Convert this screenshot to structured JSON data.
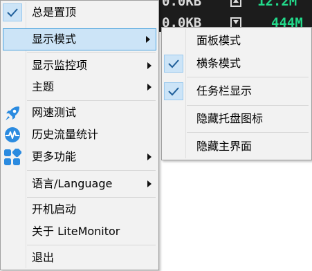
{
  "background": {
    "top_row": {
      "speed": "0.0KB",
      "value": "12.2M"
    },
    "second_row": {
      "speed": "0.0KB",
      "value": "444M"
    },
    "accent_color": "#22d98a"
  },
  "main_menu": {
    "items": [
      {
        "label": "总是置顶",
        "checked": true
      },
      {
        "label": "显示模式",
        "has_submenu": true,
        "highlighted": true
      },
      {
        "label": "显示监控项",
        "has_submenu": true
      },
      {
        "label": "主题",
        "has_submenu": true
      },
      {
        "label": "网速测试",
        "icon": "rocket-icon"
      },
      {
        "label": "历史流量统计",
        "icon": "pulse-icon"
      },
      {
        "label": "更多功能",
        "has_submenu": true,
        "icon": "grid-icon"
      },
      {
        "label": "语言/Language",
        "has_submenu": true
      },
      {
        "label": "开机启动"
      },
      {
        "label": "关于 LiteMonitor"
      },
      {
        "label": "退出"
      }
    ]
  },
  "display_mode_submenu": {
    "items": [
      {
        "label": "面板模式",
        "checked": false
      },
      {
        "label": "横条模式",
        "checked": true
      },
      {
        "label": "任务栏显示",
        "checked": true
      },
      {
        "label": "隐藏托盘图标",
        "checked": false
      },
      {
        "label": "隐藏主界面",
        "checked": false
      }
    ]
  }
}
